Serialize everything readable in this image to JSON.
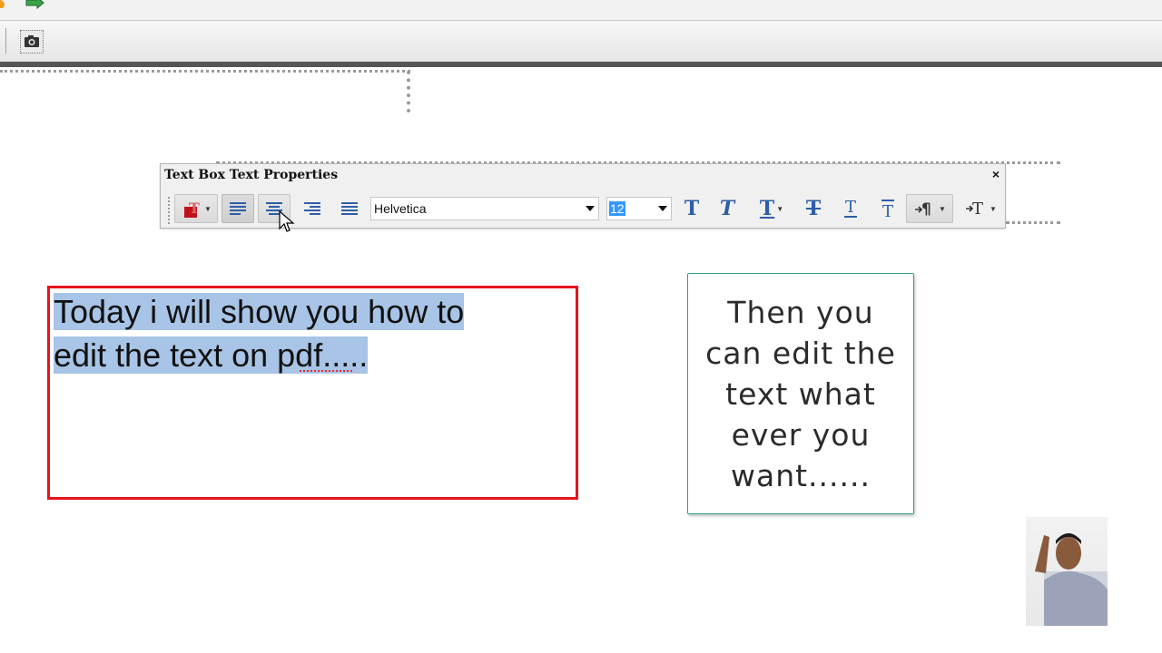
{
  "properties_window": {
    "title": "Text Box Text Properties",
    "close_glyph": "×",
    "font_name": "Helvetica",
    "font_size": "12",
    "text_color": "#c0101a",
    "icon_color": "#2e5ea8",
    "buttons": [
      {
        "name": "text-color-icon"
      },
      {
        "name": "align-left-icon"
      },
      {
        "name": "align-center-icon"
      },
      {
        "name": "align-right-icon"
      },
      {
        "name": "align-justify-icon"
      },
      {
        "name": "bold-text-icon"
      },
      {
        "name": "italic-text-icon"
      },
      {
        "name": "underline-text-icon"
      },
      {
        "name": "strikethrough-text-icon"
      },
      {
        "name": "superscript-text-icon"
      },
      {
        "name": "subscript-text-icon"
      },
      {
        "name": "paragraph-direction-icon"
      },
      {
        "name": "text-spacing-icon"
      }
    ]
  },
  "editor": {
    "text_line1": "Today i will show you how to",
    "text_line2": "edit the text on pdf.....",
    "border_color": "#e8131b",
    "selection_color": "#a8c4e6"
  },
  "callout": {
    "text": "Then you can edit the text what ever you want......",
    "border_color": "#2fa08a"
  },
  "toolbar": {
    "snapshot_icon": "camera-icon"
  }
}
